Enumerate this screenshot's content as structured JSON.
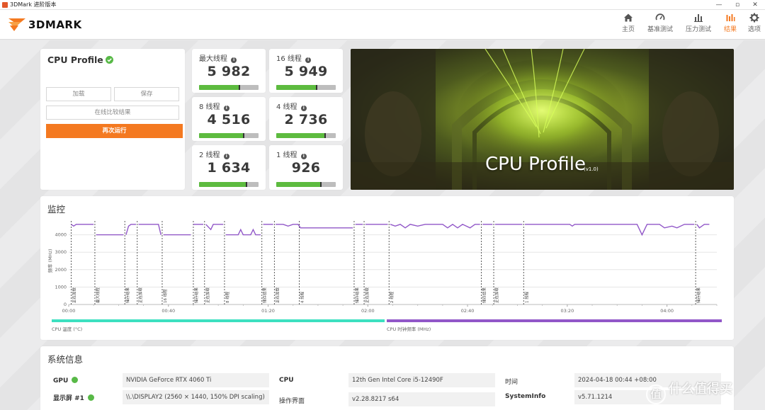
{
  "window": {
    "title": "3DMark 进阶版本"
  },
  "header": {
    "logo_text": "3DMARK",
    "nav": [
      {
        "label": "主页",
        "icon": "home-icon"
      },
      {
        "label": "基准测试",
        "icon": "gauge-icon"
      },
      {
        "label": "压力测试",
        "icon": "bar-chart-icon"
      },
      {
        "label": "结果",
        "icon": "results-icon",
        "active": true
      },
      {
        "label": "选项",
        "icon": "gear-icon"
      }
    ],
    "accent_color": "#f47920"
  },
  "benchmark": {
    "title": "CPU Profile",
    "load_label": "加载",
    "save_label": "保存",
    "compare_label": "在线比较结果",
    "run_again_label": "再次运行"
  },
  "scores": [
    {
      "label": "最大线程",
      "value": "5 982",
      "bar_fill": 0.68,
      "marker": 0.68
    },
    {
      "label": "16 线程",
      "value": "5 949",
      "bar_fill": 0.68,
      "marker": 0.68
    },
    {
      "label": "8 线程",
      "value": "4 516",
      "bar_fill": 0.75,
      "marker": 0.75
    },
    {
      "label": "4 线程",
      "value": "2 736",
      "bar_fill": 0.82,
      "marker": 0.82
    },
    {
      "label": "2 线程",
      "value": "1 634",
      "bar_fill": 0.8,
      "marker": 0.8
    },
    {
      "label": "1 线程",
      "value": "926",
      "bar_fill": 0.75,
      "marker": 0.75
    }
  ],
  "hero": {
    "title": "CPU Profile",
    "version": "(v1.0)"
  },
  "monitor": {
    "title": "监控",
    "legend": [
      {
        "label": "CPU 温度 (°C)",
        "color": "#3de0c0"
      },
      {
        "label": "CPU 时钟频率 (MHz)",
        "color": "#9157c8"
      }
    ]
  },
  "chart_data": {
    "type": "line",
    "ylabel": "频率 (MHz)",
    "yticks": [
      0,
      1000,
      2000,
      3000,
      4000
    ],
    "ylim": [
      0,
      5000
    ],
    "xticks": [
      "00:00",
      "00:40",
      "01:20",
      "02:00",
      "02:40",
      "03:20",
      "04:00"
    ],
    "xlim_seconds": [
      0,
      260
    ],
    "series": [
      {
        "name": "CPU 时钟频率 (MHz)",
        "segments": [
          [
            [
              1,
              4600
            ],
            [
              2,
              4500
            ],
            [
              3,
              4600
            ],
            [
              10,
              4600
            ]
          ],
          [
            [
              11,
              4000
            ],
            [
              22,
              4000
            ]
          ],
          [
            [
              23,
              4000
            ],
            [
              24,
              4500
            ],
            [
              25,
              4600
            ],
            [
              27,
              4600
            ]
          ],
          [
            [
              28,
              4600
            ],
            [
              36,
              4600
            ],
            [
              37,
              4000
            ]
          ],
          [
            [
              38,
              4000
            ],
            [
              49,
              4000
            ]
          ],
          [
            [
              50,
              4600
            ],
            [
              54,
              4600
            ]
          ],
          [
            [
              55,
              4600
            ],
            [
              57,
              4300
            ],
            [
              58,
              4600
            ],
            [
              62,
              4600
            ]
          ],
          [
            [
              63,
              4000
            ],
            [
              68,
              4000
            ],
            [
              69,
              4300
            ],
            [
              70,
              4000
            ],
            [
              73,
              4000
            ],
            [
              74,
              4300
            ],
            [
              75,
              4000
            ],
            [
              77,
              4000
            ]
          ],
          [
            [
              78,
              4600
            ],
            [
              82,
              4600
            ]
          ],
          [
            [
              83,
              4600
            ],
            [
              86,
              4600
            ],
            [
              88,
              4500
            ],
            [
              90,
              4600
            ],
            [
              92,
              4600
            ],
            [
              93,
              4400
            ],
            [
              114,
              4400
            ]
          ],
          [
            [
              115,
              4600
            ],
            [
              118,
              4600
            ]
          ],
          [
            [
              119,
              4600
            ],
            [
              128,
              4600
            ]
          ],
          [
            [
              129,
              4600
            ],
            [
              131,
              4500
            ],
            [
              133,
              4600
            ],
            [
              135,
              4400
            ],
            [
              137,
              4600
            ],
            [
              140,
              4500
            ],
            [
              143,
              4600
            ],
            [
              150,
              4600
            ],
            [
              152,
              4400
            ],
            [
              154,
              4600
            ],
            [
              156,
              4400
            ],
            [
              158,
              4600
            ],
            [
              161,
              4400
            ],
            [
              163,
              4600
            ],
            [
              165,
              4600
            ]
          ],
          [
            [
              166,
              4600
            ],
            [
              170,
              4600
            ]
          ],
          [
            [
              171,
              4600
            ],
            [
              182,
              4600
            ]
          ],
          [
            [
              183,
              4600
            ],
            [
              201,
              4600
            ],
            [
              202,
              4500
            ],
            [
              203,
              4600
            ],
            [
              228,
              4600
            ],
            [
              230,
              4000
            ],
            [
              232,
              4600
            ],
            [
              237,
              4600
            ],
            [
              239,
              4400
            ],
            [
              242,
              4500
            ],
            [
              244,
              4400
            ],
            [
              247,
              4600
            ],
            [
              251,
              4600
            ]
          ],
          [
            [
              252,
              4600
            ],
            [
              253,
              4400
            ],
            [
              255,
              4600
            ],
            [
              257,
              4600
            ]
          ]
        ]
      }
    ],
    "markers": [
      {
        "t": 1,
        "label": "正在加载"
      },
      {
        "t": 10.5,
        "label": "最大线程"
      },
      {
        "t": 22.5,
        "label": "储存结果"
      },
      {
        "t": 27.5,
        "label": "正在加载"
      },
      {
        "t": 37.5,
        "label": "16 线程"
      },
      {
        "t": 50,
        "label": "储存结果"
      },
      {
        "t": 54.5,
        "label": "正在加载"
      },
      {
        "t": 62.5,
        "label": "8 线程"
      },
      {
        "t": 77.5,
        "label": "储存结果"
      },
      {
        "t": 82.5,
        "label": "正在加载"
      },
      {
        "t": 92.5,
        "label": "4 线程"
      },
      {
        "t": 114.5,
        "label": "储存结果"
      },
      {
        "t": 118.5,
        "label": "正在加载"
      },
      {
        "t": 128.5,
        "label": "2 线程"
      },
      {
        "t": 165.5,
        "label": "储存结果"
      },
      {
        "t": 170.5,
        "label": "正在加载"
      },
      {
        "t": 182.5,
        "label": "1 线程"
      },
      {
        "t": 251.5,
        "label": "储存结果"
      }
    ]
  },
  "system_info": {
    "title": "系统信息",
    "gpu_label": "GPU",
    "gpu_value": "NVIDIA GeForce RTX 4060 Ti",
    "display_label": "显示屏 #1",
    "display_value": "\\\\.\\DISPLAY2 (2560 × 1440, 150% DPI scaling)",
    "cpu_label": "CPU",
    "cpu_value": "12th Gen Intel Core i5-12490F",
    "os_label": "操作界面",
    "os_value": "v2.28.8217 s64",
    "time_label": "时间",
    "time_value": "2024-04-18 00:44 +08:00",
    "sysinfo_label": "SystemInfo",
    "sysinfo_value": "v5.71.1214"
  },
  "watermark": {
    "text": "什么值得买",
    "icon": "值"
  }
}
